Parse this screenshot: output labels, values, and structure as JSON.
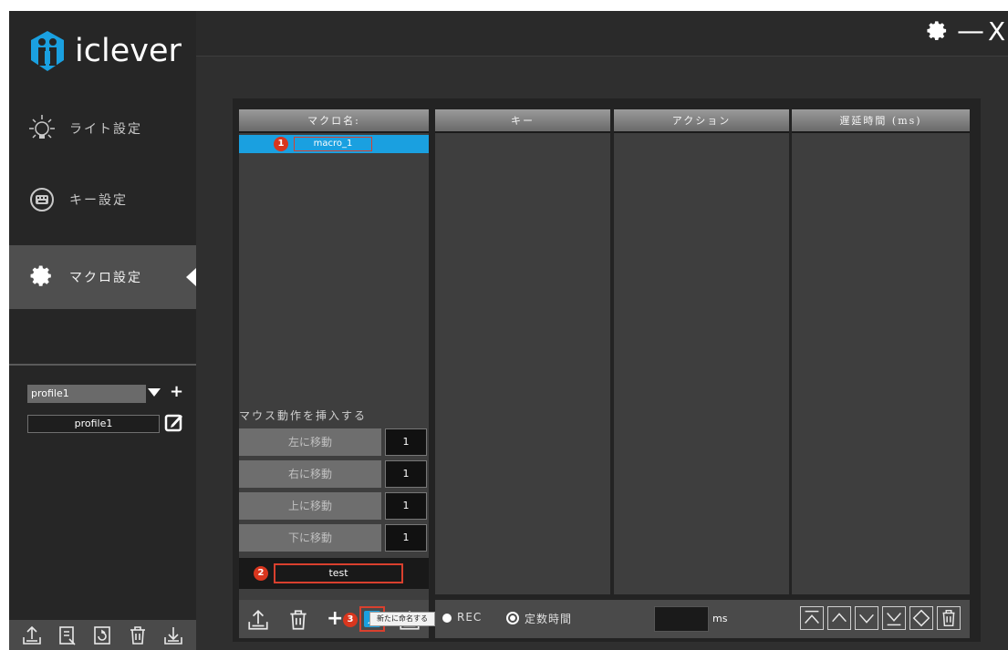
{
  "window": {
    "settings_icon": "gear-icon",
    "minimize_glyph": "—",
    "close_glyph": "X"
  },
  "logo": {
    "text": "iclever",
    "color": "#1aa0e0"
  },
  "sidebar": {
    "items": [
      {
        "label": "ライト設定",
        "icon": "bulb-icon"
      },
      {
        "label": "キー設定",
        "icon": "keyboard-icon"
      },
      {
        "label": "マクロ設定",
        "icon": "gear-icon"
      }
    ],
    "profile": {
      "selected": "profile1",
      "add_glyph": "+",
      "name_value": "profile1"
    }
  },
  "macro": {
    "header": "マクロ名:",
    "items": [
      {
        "name": "macro_1"
      }
    ],
    "mouse_label": "マウス動作を挿入する",
    "moves": [
      {
        "label": "左に移動",
        "value": "1"
      },
      {
        "label": "右に移動",
        "value": "1"
      },
      {
        "label": "上に移動",
        "value": "1"
      },
      {
        "label": "下に移動",
        "value": "1"
      }
    ],
    "rename_value": "test",
    "badges": [
      "1",
      "2",
      "3"
    ],
    "toolbar_add_glyph": "+",
    "tooltip": "新たに命名する"
  },
  "table": {
    "columns": [
      "キー",
      "アクション",
      "遅延時間 (ms)"
    ]
  },
  "record": {
    "rec_label": "REC",
    "fixed_label": "定数時間",
    "ms_value": "",
    "ms_unit": "ms"
  },
  "colors": {
    "accent": "#1aa0e0",
    "highlight_red": "#d9402e",
    "badge_red": "#d9361e"
  }
}
